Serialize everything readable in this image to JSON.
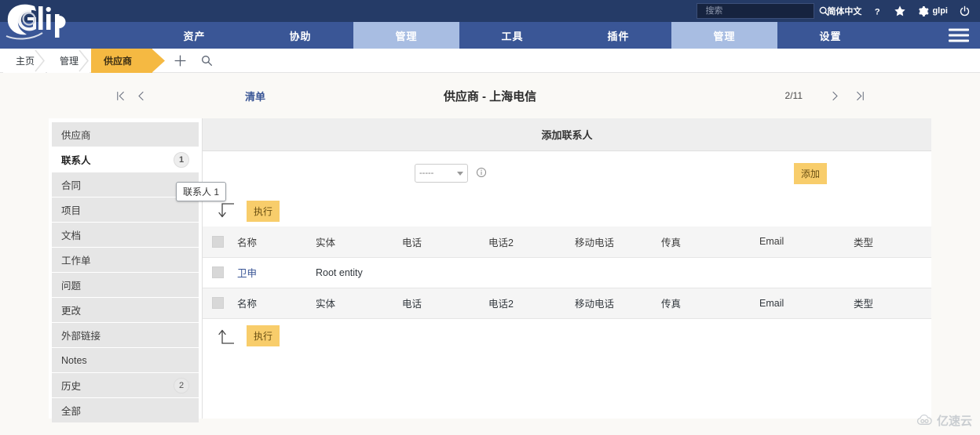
{
  "topbar": {
    "search_placeholder": "搜索",
    "search_value": "",
    "language": "简体中文",
    "user": "glpi",
    "icons": {
      "search": "search-icon",
      "help": "help-icon",
      "star": "favorite-star-icon",
      "gear": "gear-icon",
      "power": "power-off-icon"
    }
  },
  "brand": {
    "name": "glpi"
  },
  "mainnav": {
    "tabs": [
      {
        "label": "资产",
        "active": false
      },
      {
        "label": "协助",
        "active": false
      },
      {
        "label": "管理",
        "active": true
      },
      {
        "label": "工具",
        "active": false
      },
      {
        "label": "插件",
        "active": false
      },
      {
        "label": "管理",
        "active": true
      },
      {
        "label": "设置",
        "active": false
      }
    ],
    "menu_icon": "hamburger-menu-icon"
  },
  "breadcrumb": {
    "items": [
      {
        "label": "主页",
        "current": false
      },
      {
        "label": "管理",
        "current": false
      },
      {
        "label": "供应商",
        "current": true
      }
    ],
    "add_icon": "plus-icon",
    "search_icon": "search-icon"
  },
  "pagenav": {
    "first_icon": "first-page-icon",
    "prev_icon": "previous-page-icon",
    "list_label": "清单",
    "title": "供应商 - 上海电信",
    "counter": "2/11",
    "next_icon": "next-page-icon",
    "last_icon": "last-page-icon"
  },
  "sidebar": {
    "items": [
      {
        "label": "供应商",
        "badge": "",
        "active": false
      },
      {
        "label": "联系人",
        "badge": "1",
        "active": true
      },
      {
        "label": "合同",
        "badge": "",
        "active": false
      },
      {
        "label": "项目",
        "badge": "",
        "active": false
      },
      {
        "label": "文档",
        "badge": "",
        "active": false
      },
      {
        "label": "工作单",
        "badge": "",
        "active": false
      },
      {
        "label": "问题",
        "badge": "",
        "active": false
      },
      {
        "label": "更改",
        "badge": "",
        "active": false
      },
      {
        "label": "外部链接",
        "badge": "",
        "active": false
      },
      {
        "label": "Notes",
        "badge": "",
        "active": false
      },
      {
        "label": "历史",
        "badge": "2",
        "active": false
      },
      {
        "label": "全部",
        "badge": "",
        "active": false
      }
    ],
    "tooltip": "联系人 1"
  },
  "main": {
    "panel_title": "添加联系人",
    "select_value": "-----",
    "info_icon": "info-circle-icon",
    "add_button": "添加",
    "exec_top": {
      "arrow_icon": "arrow-down-left-icon",
      "label": "执行"
    },
    "exec_bottom": {
      "arrow_icon": "arrow-up-left-icon",
      "label": "执行"
    },
    "table": {
      "headers": [
        "名称",
        "实体",
        "电话",
        "电话2",
        "移动电话",
        "传真",
        "Email",
        "类型"
      ],
      "footers": [
        "名称",
        "实体",
        "电话",
        "电话2",
        "移动电话",
        "传真",
        "Email",
        "类型"
      ],
      "rows": [
        {
          "name": "卫申",
          "entity": "Root entity",
          "phone": "",
          "phone2": "",
          "mobile": "",
          "fax": "",
          "email": "",
          "type": ""
        }
      ]
    }
  },
  "watermark": {
    "text": "亿速云"
  },
  "colors": {
    "topbar": "#253b67",
    "nav": "#3a5696",
    "nav_active": "#a8bde2",
    "accent_orange": "#f5b942",
    "button_orange": "#f8cd6b",
    "page_bg": "#faf9f6",
    "link_blue": "#3a5696"
  }
}
